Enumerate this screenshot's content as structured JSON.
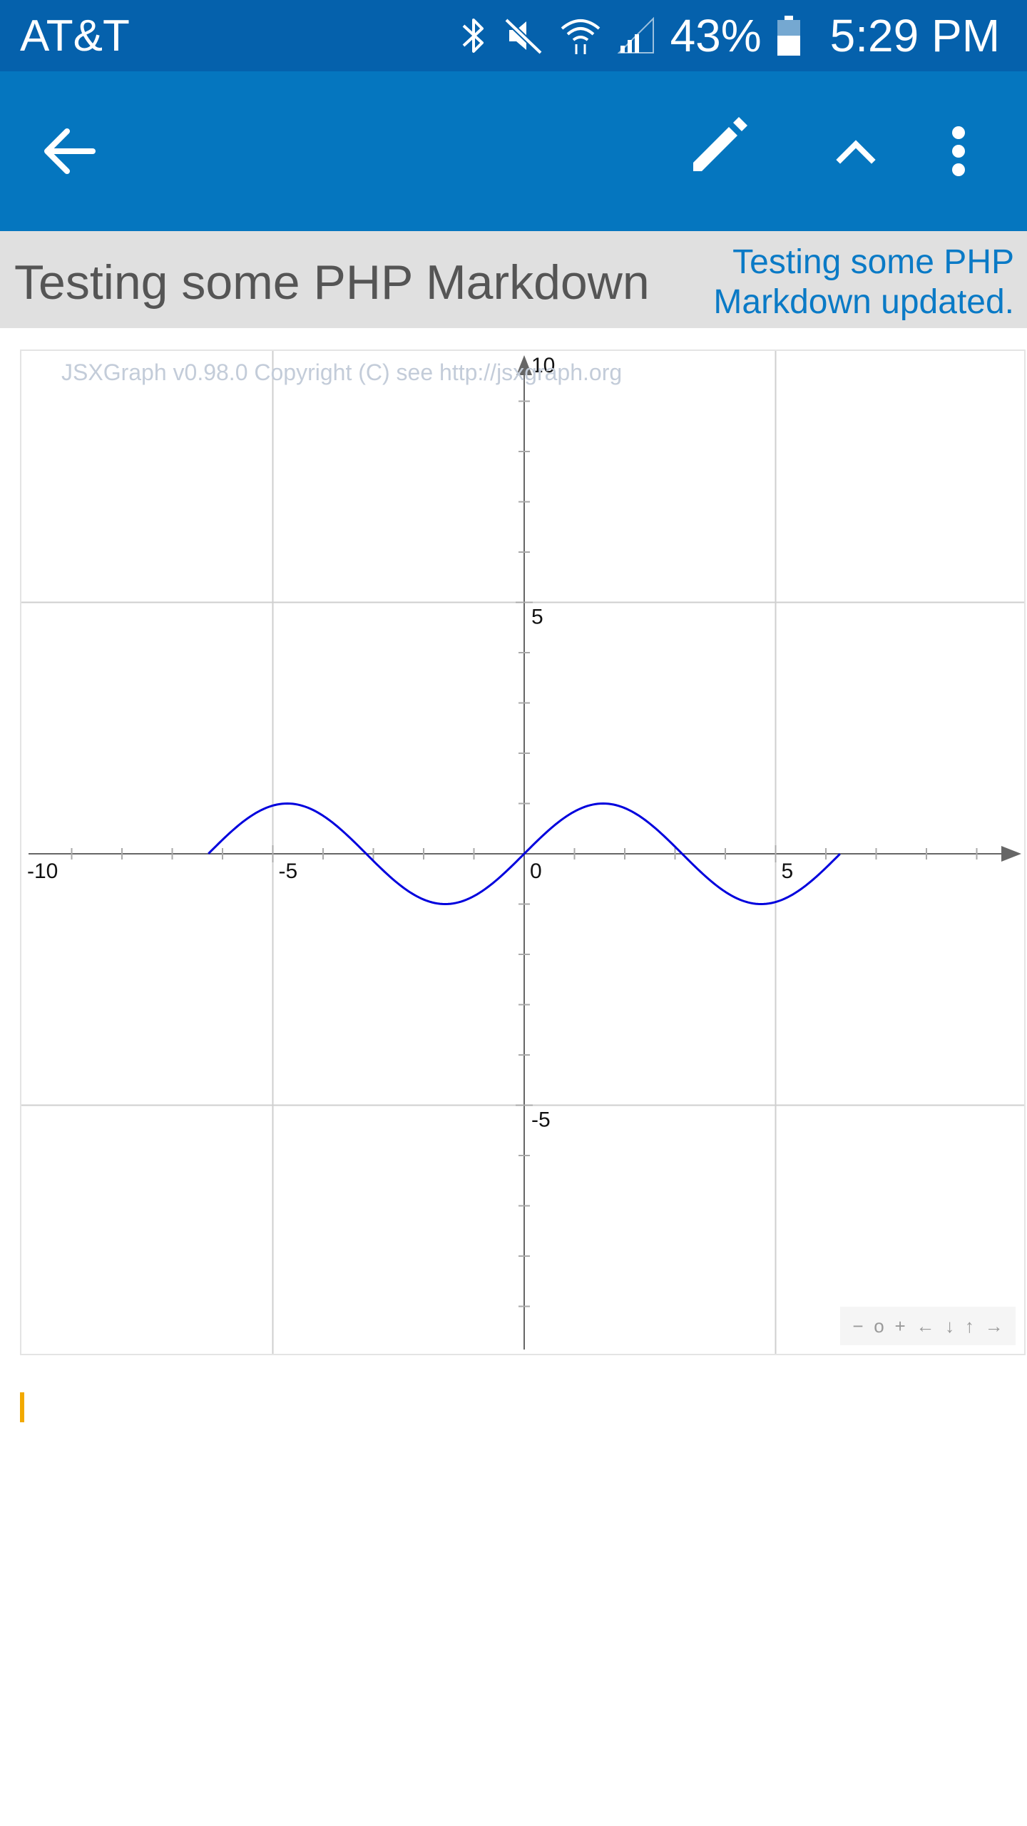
{
  "status_bar": {
    "carrier": "AT&T",
    "battery": "43%",
    "time": "5:29 PM",
    "icons": [
      "bluetooth-icon",
      "mute-icon",
      "wifi-icon",
      "signal-icon",
      "battery-icon"
    ]
  },
  "app_bar": {
    "background": "#0576bf",
    "icons": [
      "back-arrow-icon",
      "edit-pencil-icon",
      "chevron-up-icon",
      "more-vert-icon"
    ]
  },
  "page": {
    "title": "Testing some PHP Markdown",
    "subtitle": "Testing some PHP Markdown  updated."
  },
  "graph": {
    "copyright": "JSXGraph v0.98.0 Copyright (C) see http://jsxgraph.org",
    "nav": [
      "−",
      "o",
      "+",
      "←",
      "↓",
      "↑",
      "→"
    ]
  },
  "chart_data": {
    "type": "line",
    "title": "",
    "xlabel": "",
    "ylabel": "",
    "xlim": [
      -10,
      10
    ],
    "ylim": [
      -10,
      10
    ],
    "grid": true,
    "x_tick_labels": [
      "-10",
      "-5",
      "0",
      "5"
    ],
    "y_tick_labels": [
      "10",
      "5",
      "-5"
    ],
    "series": [
      {
        "color": "#0000dd",
        "function": "sin(x)",
        "x": [
          -6.28,
          -5.5,
          -4.71,
          -3.93,
          -3.14,
          -2.36,
          -1.57,
          -0.79,
          0,
          0.79,
          1.57,
          2.36,
          3.14,
          3.93,
          4.71,
          5.5,
          6.28
        ],
        "y": [
          0,
          0.71,
          1,
          0.71,
          0,
          -0.71,
          -1,
          -0.71,
          0,
          0.71,
          1,
          0.71,
          0,
          -0.71,
          -1,
          -0.71,
          0
        ]
      }
    ]
  }
}
